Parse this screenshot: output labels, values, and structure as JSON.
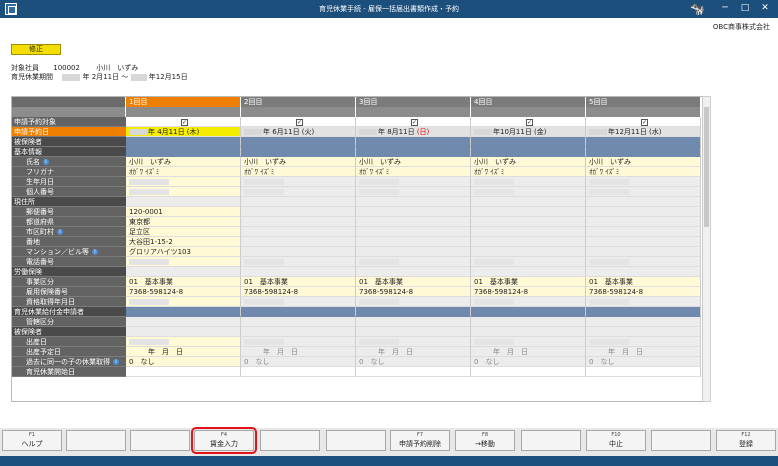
{
  "window": {
    "title": "育児休業手続 - 雇保一括届出書類作成・予約",
    "company": "OBC商事株式会社",
    "cow_icon": "cow-mascot-icon"
  },
  "header": {
    "mode_label": "修正",
    "employee_label": "対象社員",
    "employee_code": "100002",
    "employee_name": "小川　いずみ",
    "period_label": "育児休業期間",
    "period_text": "年 2月11日 ～",
    "period_end": "年12月15日"
  },
  "columns": [
    {
      "label": "1回目",
      "date": "年  4月11日 (木)"
    },
    {
      "label": "2回目",
      "date": "年  6月11日 (火)"
    },
    {
      "label": "3回目",
      "date": "年  8月11日",
      "date_red": "(日)"
    },
    {
      "label": "4回目",
      "date": "年10月11日 (金)"
    },
    {
      "label": "5回目",
      "date": "年12月11日 (水)"
    }
  ],
  "rows": {
    "reserve_target": "申請予約対象",
    "reserve_date": "申請予約日",
    "insured": "被保険者",
    "basic_info": "基本情報",
    "name": "氏名",
    "furigana": "フリガナ",
    "birthdate": "生年月日",
    "personal_no": "個人番号",
    "address_section": "現住所",
    "postal": "郵便番号",
    "prefecture": "都道府県",
    "city": "市区町村",
    "street": "番地",
    "building": "マンション／ビル等",
    "phone": "電話番号",
    "labor_section": "労働保険",
    "office_class": "事業区分",
    "employment_no": "雇用保険番号",
    "acquired_date": "資格取得年月日",
    "benefit_section": "育児休業給付金申請者",
    "jurisdiction": "管轄区分",
    "insured2": "被保険者",
    "birth_date": "出産日",
    "due_date": "出産予定日",
    "past_leave": "過去に同一の子の休業取得",
    "leave_start": "育児休業開始日"
  },
  "values": {
    "check": "✓",
    "name": "小川　いずみ",
    "furigana": "ｵｶﾞﾜ ｲｽﾞﾐ",
    "postal": "120-0001",
    "prefecture": "東京都",
    "city": "足立区",
    "street": "大谷田1-15-2",
    "building": "グロリアハイツ103",
    "office_code": "01",
    "office_name": "基本事業",
    "employment_no": "7368-598124-8",
    "due_date": "年　月　日",
    "past_code": "0",
    "past_text": "なし"
  },
  "fkeys": [
    {
      "key": "F1",
      "label": "ヘルプ"
    },
    {
      "key": "",
      "label": ""
    },
    {
      "key": "",
      "label": ""
    },
    {
      "key": "F4",
      "label": "賃金入力"
    },
    {
      "key": "",
      "label": ""
    },
    {
      "key": "",
      "label": ""
    },
    {
      "key": "F7",
      "label": "申請予約削除"
    },
    {
      "key": "F8",
      "label": "→移動"
    },
    {
      "key": "",
      "label": ""
    },
    {
      "key": "F10",
      "label": "中止"
    },
    {
      "key": "",
      "label": ""
    },
    {
      "key": "F12",
      "label": "登録"
    }
  ]
}
